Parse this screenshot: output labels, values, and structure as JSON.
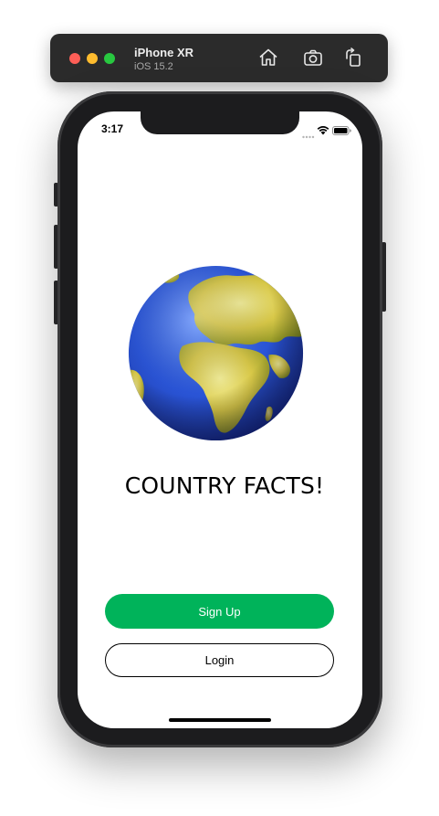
{
  "simulator": {
    "device_name": "iPhone XR",
    "os_version": "iOS 15.2"
  },
  "status_bar": {
    "time": "3:17"
  },
  "app": {
    "title": "COUNTRY FACTS!",
    "signup_label": "Sign Up",
    "login_label": "Login"
  },
  "colors": {
    "primary": "#00b35a",
    "toolbar_bg": "#2b2b2b"
  },
  "icons": {
    "globe": "earth-globe-europe-africa",
    "home": "home-icon",
    "screenshot": "camera-icon",
    "rotate": "rotate-icon"
  }
}
